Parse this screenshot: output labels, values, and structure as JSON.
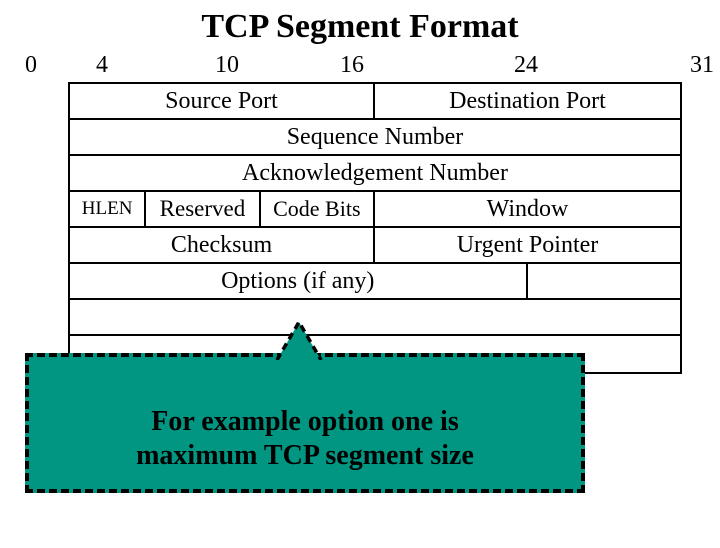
{
  "title": "TCP Segment Format",
  "ruler": {
    "t0": "0",
    "t4": "4",
    "t10": "10",
    "t16": "16",
    "t24": "24",
    "t31": "31"
  },
  "rows": {
    "source_port": "Source Port",
    "dest_port": "Destination Port",
    "seq": "Sequence Number",
    "ack": "Acknowledgement Number",
    "hlen": "HLEN",
    "reserved": "Reserved",
    "codebits": "Code Bits",
    "window": "Window",
    "checksum": "Checksum",
    "urgent": "Urgent Pointer",
    "options": "Options (if any)"
  },
  "callout": {
    "line1": "For example option one is",
    "line2": "maximum TCP segment size"
  }
}
